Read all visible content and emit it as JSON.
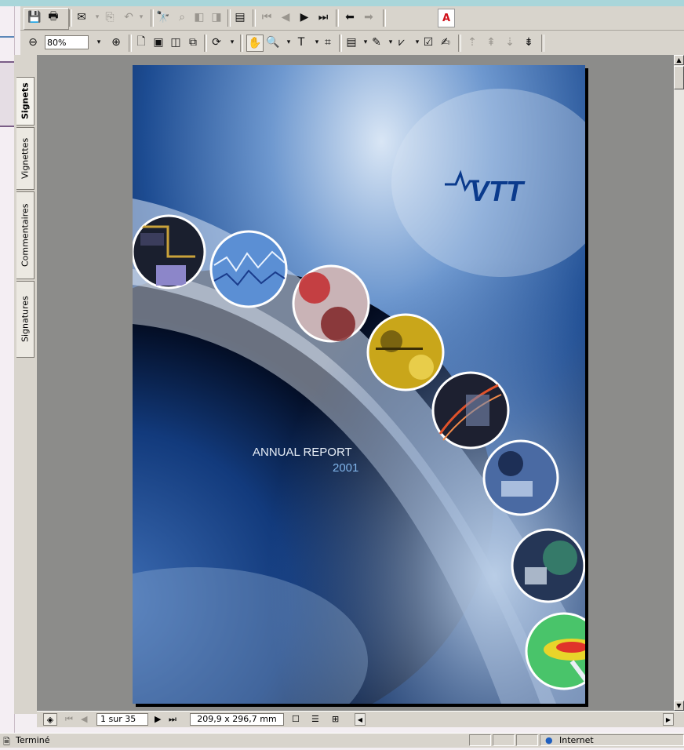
{
  "toolbar2": {
    "zoom_value": "80%"
  },
  "side_tabs": [
    "Signets",
    "Vignettes",
    "Commentaires",
    "Signatures"
  ],
  "document": {
    "title": "ANNUAL REPORT",
    "year": "2001",
    "logo_text": "VTT"
  },
  "navigation": {
    "page_indicator": "1 sur 35",
    "page_size": "209,9 x 296,7 mm"
  },
  "status": {
    "left_text": "Terminé",
    "zone_text": "Internet"
  },
  "colors": {
    "page_bg": "#0c2f66",
    "logo": "#0a3a8c",
    "report_title": "#e6edf6",
    "report_year": "#7fb3e8"
  }
}
